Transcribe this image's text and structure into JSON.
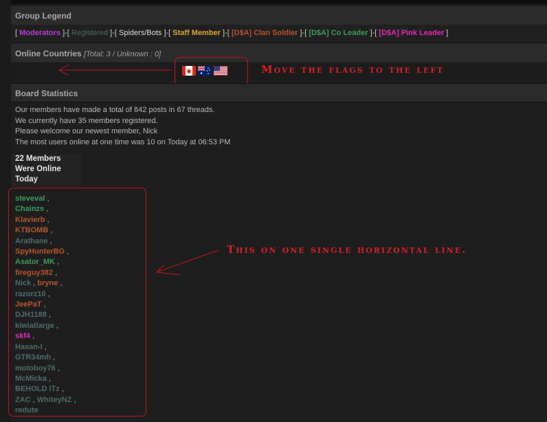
{
  "group_legend": {
    "title": "Group Legend",
    "groups": [
      {
        "name": "Moderators",
        "color": "#b43ed2"
      },
      {
        "name": "Registered",
        "color": "#4f6a6a"
      },
      {
        "name": "Spiders/Bots",
        "color": "#dcdcdc"
      },
      {
        "name": "Staff Member",
        "color": "#d9a63a"
      },
      {
        "name": "[D$A] Clan Soldier",
        "color": "#b5542b"
      },
      {
        "name": "[D$A] Co Leader",
        "color": "#3f9a5d"
      },
      {
        "name": "[D$A] Pink Leader",
        "color": "#e02ab4"
      }
    ]
  },
  "online_countries": {
    "title": "Online Countries",
    "summary": "[Total: 3 / Unknown : 0]",
    "flags": [
      "canada-flag-icon",
      "australia-flag-icon",
      "usa-flag-icon"
    ]
  },
  "board_statistics": {
    "title": "Board Statistics",
    "lines": [
      "Our members have made a total of 842 posts in 67 threads.",
      "We currently have 35 members registered.",
      "Please welcome our newest member, Nick",
      "The most users online at one time was 10 on Today at 06:53 PM"
    ]
  },
  "online_today": {
    "heading_lines": [
      "22 Members",
      "Were Online",
      "Today"
    ],
    "rows": [
      [
        {
          "name": "steveval",
          "color": "#3f9a5d"
        }
      ],
      [
        {
          "name": "Chainzs",
          "color": "#3f9a5d"
        }
      ],
      [
        {
          "name": "Klavierb",
          "color": "#b5542b"
        }
      ],
      [
        {
          "name": "KTBOMB",
          "color": "#b5542b"
        }
      ],
      [
        {
          "name": "Arathane",
          "color": "#4f6a6a"
        }
      ],
      [
        {
          "name": "SpyHunterBG",
          "color": "#b5542b"
        }
      ],
      [
        {
          "name": "Asator_MK",
          "color": "#3f9a5d"
        }
      ],
      [
        {
          "name": "fireguy382",
          "color": "#b5542b"
        }
      ],
      [
        {
          "name": "Nick",
          "color": "#4f6a6a"
        },
        {
          "name": "bryne",
          "color": "#b5542b"
        }
      ],
      [
        {
          "name": "razorz10",
          "color": "#4f6a6a"
        }
      ],
      [
        {
          "name": "JeePaT",
          "color": "#b5542b"
        }
      ],
      [
        {
          "name": "DJH1188",
          "color": "#4f6a6a"
        }
      ],
      [
        {
          "name": "kiwiatlarge",
          "color": "#4f6a6a"
        }
      ],
      [
        {
          "name": "skf4",
          "color": "#e02ab4"
        }
      ],
      [
        {
          "name": "Hasan-I",
          "color": "#4f6a6a"
        }
      ],
      [
        {
          "name": "GTR34mh",
          "color": "#4f6a6a"
        }
      ],
      [
        {
          "name": "motoboy76",
          "color": "#4f6a6a"
        }
      ],
      [
        {
          "name": "McMicka",
          "color": "#4f6a6a"
        }
      ],
      [
        {
          "name": "BEHOLD iTz",
          "color": "#4f6a6a"
        }
      ],
      [
        {
          "name": "ZAC",
          "color": "#4f6a6a"
        },
        {
          "name": "WhiteyNZ",
          "color": "#4f6a6a"
        }
      ],
      [
        {
          "name": "redute",
          "color": "#4f6a6a"
        }
      ]
    ]
  },
  "annotations": {
    "flags_note": "Move the flags to the left",
    "members_note": "This on one single horizontal line.",
    "color": "#d62028"
  }
}
